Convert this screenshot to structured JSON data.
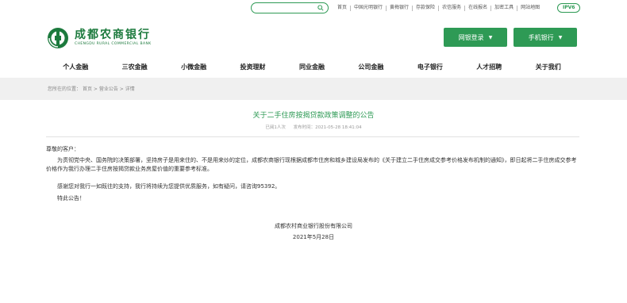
{
  "topbar": {
    "search_placeholder": "",
    "links": [
      "首页",
      "中国光明银行",
      "黄梅银行",
      "存款保险",
      "农信服务",
      "在线报名",
      "加密工具",
      "网站地图"
    ],
    "ipv6": "IPV6"
  },
  "logo": {
    "name_cn": "成都农商银行",
    "name_en": "CHENGDU RURAL COMMERCIAL BANK"
  },
  "header_buttons": {
    "netbank": "网银登录",
    "mobile": "手机银行"
  },
  "nav": [
    "个人金融",
    "三农金融",
    "小微金融",
    "投资理财",
    "同业金融",
    "公司金融",
    "电子银行",
    "人才招聘",
    "关于我们"
  ],
  "breadcrumb": {
    "prefix": "您所在的位置：",
    "items": [
      "首页",
      "营业公告",
      "详情"
    ]
  },
  "article": {
    "title": "关于二手住房按揭贷款政策调整的公告",
    "meta_source": "已阅1人次",
    "meta_date": "发布时间：2021-05-28 18:41:04",
    "greeting": "尊敬的客户：",
    "para1": "为贯彻党中央、国务院的决策部署，坚持房子是用来住的、不是用来炒的定位，成都农商银行现根据成都市住房和城乡建设局发布的《关于建立二手住房成交参考价格发布机制的通知》，即日起将二手住房成交参考价格作为我行办理二手住房按揭贷款业务房屋价值的重要参考标准。",
    "para2": "感谢您对我行一如既往的支持，我行将持续为您提供优质服务，如有疑问，请咨询95392。",
    "para3": "特此公告！",
    "sign_company": "成都农村商业银行股份有限公司",
    "sign_date": "2021年5月28日"
  },
  "colors": {
    "brand_green": "#2e9a55",
    "logo_green": "#1c7a3d",
    "crumb_bg": "#f0f0f0"
  }
}
